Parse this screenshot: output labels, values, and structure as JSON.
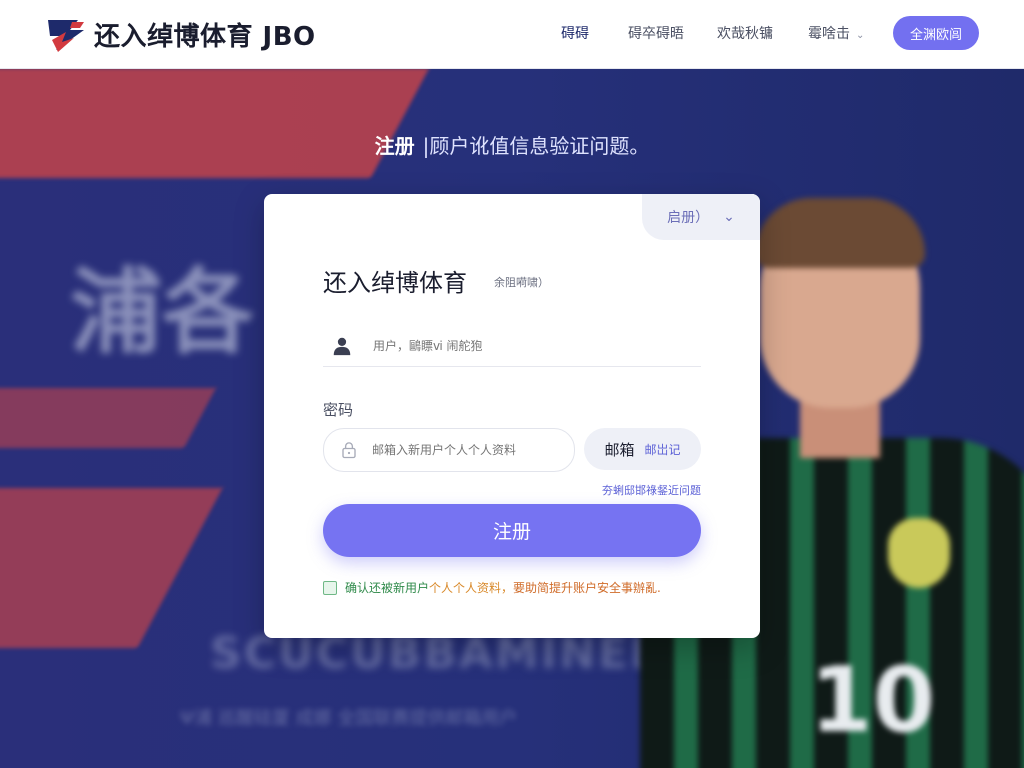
{
  "brand": {
    "name": "还入绰博体育 JBO"
  },
  "nav": {
    "items": [
      {
        "label": "碍碍"
      },
      {
        "label": "碍卒碍晤"
      },
      {
        "label": "欢哉秋镛"
      },
      {
        "label": "霉啥击"
      }
    ],
    "login_label": "全渊欧闾"
  },
  "hero": {
    "headline_bold": "注册",
    "headline_rest": "|顾户讹值信息验证问题。",
    "bg_text": "浦各",
    "bg_sub": "SCUCUBBAMINEEPO TI",
    "bg_sub2": "Ψ浦 巡醒硅厦   成娜 全国联赛提供邮箱用户"
  },
  "card": {
    "lang_label": "启册）",
    "title": "还入绰博体育",
    "subtitle": "余阻嗬啸）",
    "username_placeholder": "用户，鷗瞟ⅵ 闹舵狍",
    "password_label": "密码",
    "password_placeholder": "邮箱入新用户个人个人资料",
    "mail_button_label": "邮箱",
    "mail_link": "邮岀记",
    "forgot_label": "夯蜊邸邯祿錖近问题",
    "submit_label": "注册",
    "agree": {
      "part1": "确认还被新用户",
      "part2": "个人个人资料，",
      "part3": "要助简提升账户安全事辦亂."
    }
  },
  "colors": {
    "accent": "#7673f2",
    "hero_bg": "#26307a",
    "stripe": "#c2434a",
    "link": "#5a5fd6"
  },
  "icons": {
    "logo": "jbo-logo-icon",
    "user": "user-icon",
    "lock": "lock-icon",
    "lang_chevron": "chevron-down-icon",
    "nav_chevron": "chevron-down-icon"
  }
}
